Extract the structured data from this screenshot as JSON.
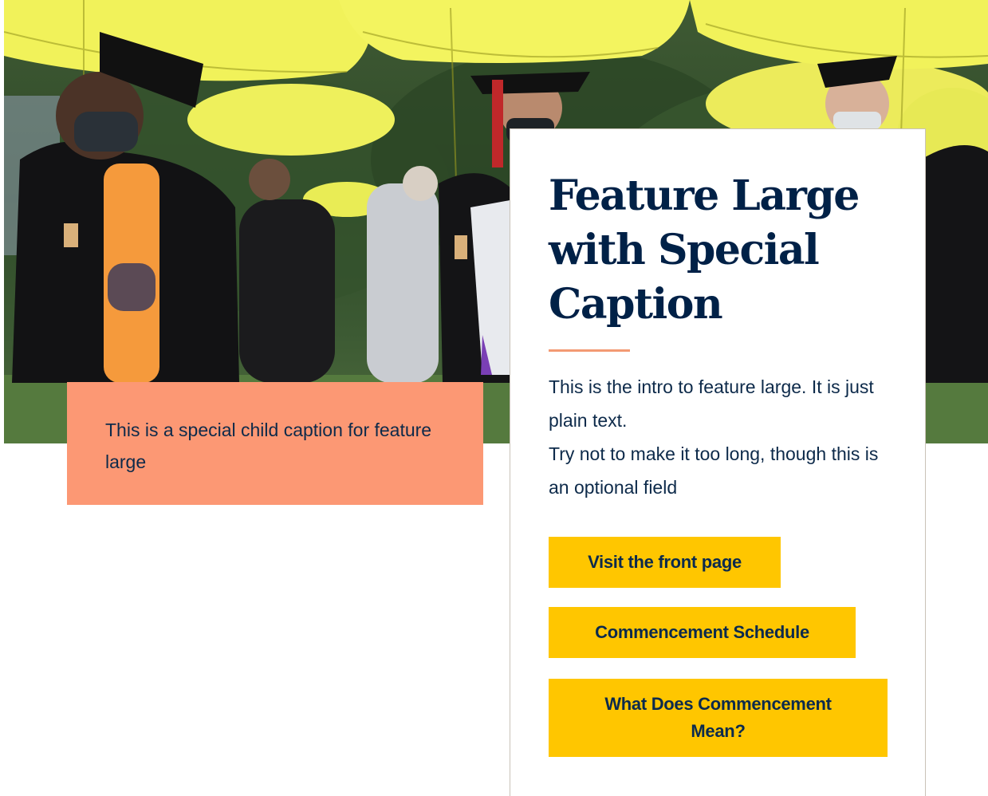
{
  "hero": {
    "image_description_icon": "graduation-photo",
    "accent_umbrella_color": "#f1f25a"
  },
  "caption": {
    "text": "This is a special child caption for feature large",
    "background_color": "#fc9874"
  },
  "feature": {
    "title": "Feature Large with Special Caption",
    "intro_line_1": "This is the intro to feature large. It is just plain text.",
    "intro_line_2": "Try not to make it too long, though this is an optional field",
    "title_color": "#002147",
    "rule_color": "#f39a73"
  },
  "buttons": [
    {
      "label": "Visit the front page"
    },
    {
      "label": "Commencement Schedule"
    },
    {
      "label": "What Does Commencement Mean?"
    }
  ],
  "colors": {
    "button_bg": "#ffc600",
    "button_text": "#0b2a4d"
  }
}
